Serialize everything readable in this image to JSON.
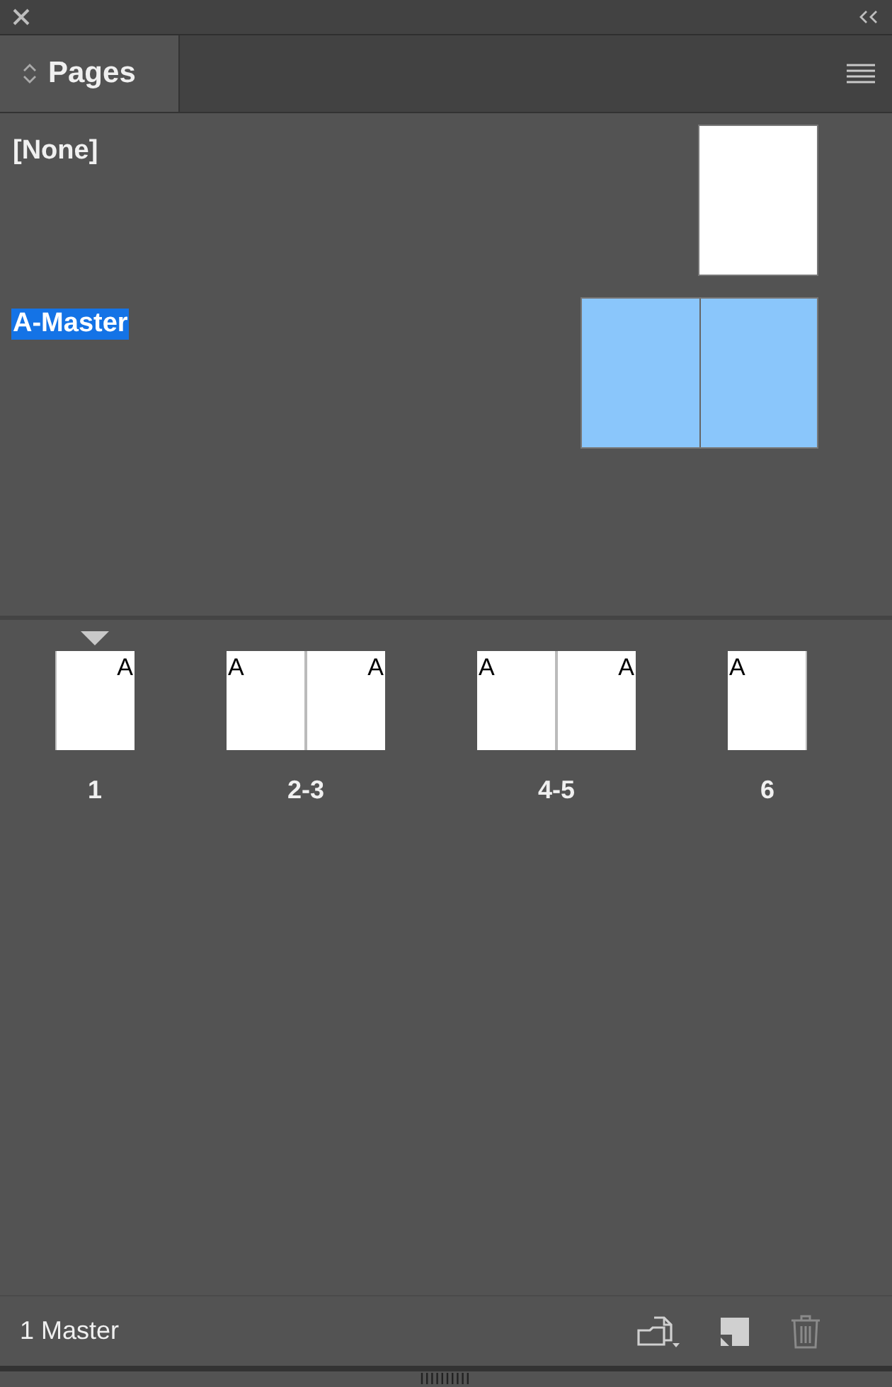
{
  "panel": {
    "tab": {
      "label": "Pages",
      "selected": true
    }
  },
  "masters": [
    {
      "name": "[None]",
      "selected": false,
      "kind": "single",
      "color": "#ffffff"
    },
    {
      "name": "A-Master",
      "selected": true,
      "kind": "spread",
      "color": "#8ac6fb"
    }
  ],
  "spreads": [
    {
      "label": "1",
      "current": true,
      "pages": [
        {
          "kind": "right",
          "master": "A"
        }
      ]
    },
    {
      "label": "2-3",
      "current": false,
      "pages": [
        {
          "kind": "left",
          "master": "A"
        },
        {
          "kind": "right",
          "master": "A"
        }
      ]
    },
    {
      "label": "4-5",
      "current": false,
      "pages": [
        {
          "kind": "left",
          "master": "A"
        },
        {
          "kind": "right",
          "master": "A"
        }
      ]
    },
    {
      "label": "6",
      "current": false,
      "pages": [
        {
          "kind": "left",
          "master": "A"
        }
      ]
    }
  ],
  "footer": {
    "status": "1 Master",
    "buttons": [
      {
        "kind": "new-from-master",
        "disabled": false
      },
      {
        "kind": "new-page",
        "disabled": false
      },
      {
        "kind": "delete",
        "disabled": true
      }
    ]
  }
}
